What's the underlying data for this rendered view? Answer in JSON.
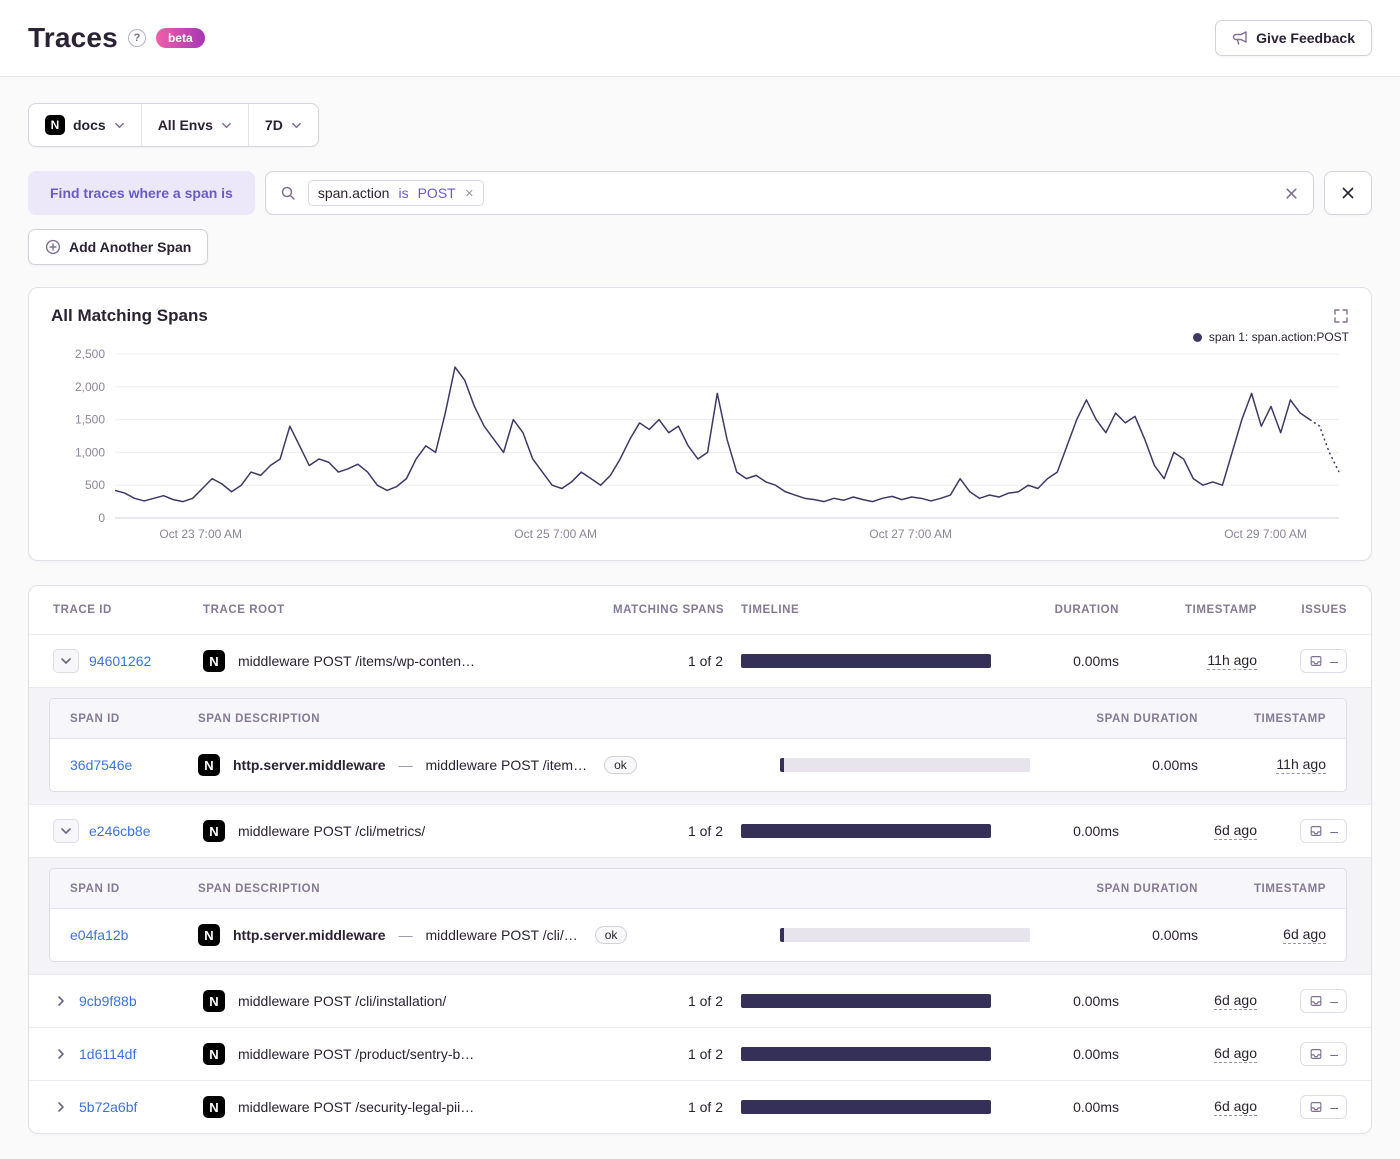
{
  "icons": {
    "help": "?",
    "close": "close-x",
    "search": "magnifier"
  },
  "header": {
    "title": "Traces",
    "beta_badge": "beta",
    "feedback_label": "Give Feedback"
  },
  "filter_bar": {
    "project_initial": "N",
    "project_label": "docs",
    "env_label": "All Envs",
    "period_label": "7D"
  },
  "span_query": {
    "where_label": "Find traces where a span is",
    "token_key": "span.action",
    "token_op": "is",
    "token_value": "POST",
    "token_remove": "✕",
    "add_button_label": "Add Another Span"
  },
  "chart_panel": {
    "title": "All Matching Spans",
    "legend_label": "span 1: span.action:POST"
  },
  "chart_data": {
    "type": "line",
    "title": "All Matching Spans",
    "legend": [
      "span 1: span.action:POST"
    ],
    "legend_position": "top-right",
    "grid": true,
    "line_color": "#3d3963",
    "ylim": [
      0,
      2500
    ],
    "yticks": [
      0,
      500,
      1000,
      1500,
      2000,
      2500
    ],
    "ytick_labels": [
      "0",
      "500",
      "1,000",
      "1,500",
      "2,000",
      "2,500"
    ],
    "xtick_labels": [
      "Oct 23 7:00 AM",
      "Oct 25 7:00 AM",
      "Oct 27 7:00 AM",
      "Oct 29 7:00 AM"
    ],
    "xtick_positions": [
      0.07,
      0.36,
      0.65,
      0.94
    ],
    "dashed_tail_points": 3,
    "series": [
      {
        "name": "span 1: span.action:POST",
        "values": [
          420,
          380,
          300,
          260,
          300,
          340,
          280,
          250,
          300,
          450,
          600,
          520,
          400,
          500,
          700,
          650,
          800,
          900,
          1400,
          1100,
          800,
          900,
          850,
          700,
          750,
          820,
          700,
          500,
          420,
          480,
          600,
          900,
          1100,
          1000,
          1600,
          2300,
          2100,
          1700,
          1400,
          1200,
          1000,
          1500,
          1300,
          900,
          700,
          500,
          450,
          550,
          700,
          600,
          500,
          650,
          900,
          1200,
          1450,
          1350,
          1500,
          1300,
          1400,
          1100,
          900,
          1000,
          1900,
          1200,
          700,
          600,
          650,
          550,
          500,
          400,
          350,
          300,
          280,
          250,
          300,
          270,
          320,
          280,
          250,
          300,
          330,
          280,
          320,
          300,
          260,
          300,
          350,
          600,
          400,
          300,
          350,
          320,
          380,
          400,
          500,
          450,
          600,
          700,
          1100,
          1500,
          1800,
          1500,
          1300,
          1600,
          1450,
          1550,
          1200,
          800,
          600,
          1000,
          900,
          600,
          500,
          550,
          500,
          1000,
          1500,
          1900,
          1400,
          1700,
          1300,
          1800,
          1600,
          1500,
          1400,
          1000,
          700
        ]
      }
    ]
  },
  "table": {
    "columns": {
      "trace_id": "TRACE ID",
      "trace_root": "TRACE ROOT",
      "matching_spans": "MATCHING SPANS",
      "timeline": "TIMELINE",
      "duration": "DURATION",
      "timestamp": "TIMESTAMP",
      "issues": "ISSUES"
    },
    "span_columns": {
      "span_id": "SPAN ID",
      "span_description": "SPAN DESCRIPTION",
      "span_duration": "SPAN DURATION",
      "timestamp": "TIMESTAMP"
    },
    "rows": [
      {
        "trace_id": "94601262",
        "platform_initial": "N",
        "trace_root": "middleware POST /items/wp-conten…",
        "matching_spans": "1 of 2",
        "duration": "0.00ms",
        "timestamp": "11h ago",
        "issues_value": "–",
        "expanded": true,
        "spans": [
          {
            "span_id": "36d7546e",
            "platform_initial": "N",
            "op": "http.server.middleware",
            "separator": "—",
            "description": "middleware POST /item…",
            "status": "ok",
            "duration": "0.00ms",
            "timestamp": "11h ago"
          }
        ]
      },
      {
        "trace_id": "e246cb8e",
        "platform_initial": "N",
        "trace_root": "middleware POST /cli/metrics/",
        "matching_spans": "1 of 2",
        "duration": "0.00ms",
        "timestamp": "6d ago",
        "issues_value": "–",
        "expanded": true,
        "spans": [
          {
            "span_id": "e04fa12b",
            "platform_initial": "N",
            "op": "http.server.middleware",
            "separator": "—",
            "description": "middleware POST /cli/…",
            "status": "ok",
            "duration": "0.00ms",
            "timestamp": "6d ago"
          }
        ]
      },
      {
        "trace_id": "9cb9f88b",
        "platform_initial": "N",
        "trace_root": "middleware POST /cli/installation/",
        "matching_spans": "1 of 2",
        "duration": "0.00ms",
        "timestamp": "6d ago",
        "issues_value": "–",
        "expanded": false,
        "spans": []
      },
      {
        "trace_id": "1d6114df",
        "platform_initial": "N",
        "trace_root": "middleware POST /product/sentry-b…",
        "matching_spans": "1 of 2",
        "duration": "0.00ms",
        "timestamp": "6d ago",
        "issues_value": "–",
        "expanded": false,
        "spans": []
      },
      {
        "trace_id": "5b72a6bf",
        "platform_initial": "N",
        "trace_root": "middleware POST /security-legal-pii…",
        "matching_spans": "1 of 2",
        "duration": "0.00ms",
        "timestamp": "6d ago",
        "issues_value": "–",
        "expanded": false,
        "spans": []
      }
    ]
  }
}
